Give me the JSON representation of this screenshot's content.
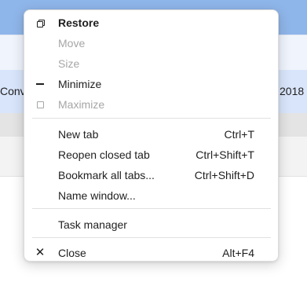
{
  "background": {
    "row_left_text": "Conv",
    "row_right_text": "C 2018"
  },
  "menu": {
    "window_items": [
      {
        "label": "Restore",
        "icon": "restore-icon",
        "state": "bold"
      },
      {
        "label": "Move",
        "icon": "",
        "state": "disabled"
      },
      {
        "label": "Size",
        "icon": "",
        "state": "disabled"
      },
      {
        "label": "Minimize",
        "icon": "minimize-icon",
        "state": "normal"
      },
      {
        "label": "Maximize",
        "icon": "maximize-icon",
        "state": "disabled"
      }
    ],
    "tab_items": [
      {
        "label": "New tab",
        "shortcut": "Ctrl+T"
      },
      {
        "label": "Reopen closed tab",
        "shortcut": "Ctrl+Shift+T"
      },
      {
        "label": "Bookmark all tabs...",
        "shortcut": "Ctrl+Shift+D"
      },
      {
        "label": "Name window...",
        "shortcut": ""
      }
    ],
    "task_manager": {
      "label": "Task manager"
    },
    "close": {
      "label": "Close",
      "shortcut": "Alt+F4",
      "icon": "close-icon",
      "glyph": "✕"
    }
  },
  "colors": {
    "titlebar": "#8fb6ea",
    "selected_row": "#d9e5fb",
    "disabled_text": "#a6a6a6",
    "text": "#1f1f1f"
  }
}
